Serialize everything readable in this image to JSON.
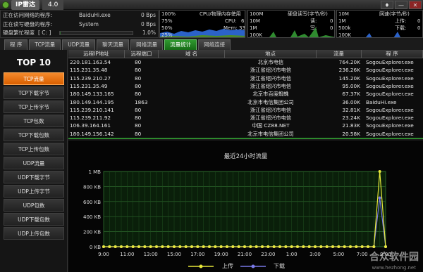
{
  "window": {
    "title": "IP雷达",
    "version": "4.0",
    "buttons": [
      "♦",
      "—",
      "✕"
    ]
  },
  "status": {
    "rows": [
      {
        "label": "正在访问网络的程序:",
        "app": "BaiduHi.exe",
        "value": "0 Bps"
      },
      {
        "label": "正在读写硬盘的程序:",
        "app": "System",
        "value": "0 Bps"
      },
      {
        "label": "硬盘繁忙程度",
        "drive": "[ C: ]",
        "value": "1.0%"
      }
    ],
    "disk_busy_percent": 1.0
  },
  "monitors": {
    "cpu": {
      "scale_top": "100%",
      "title": "CPU/物理内存使用",
      "l75": "75%",
      "cpu_label": "CPU:",
      "cpu_value": "6",
      "l50": "50%",
      "mem_label": "Mem:",
      "mem_value": "33",
      "l25": "25%"
    },
    "disk": {
      "scale_top": "100M",
      "title": "硬盘读写(字节/秒)",
      "l10m": "10M",
      "read_label": "读:",
      "read_value": "0",
      "l1m": "1M",
      "write_label": "写:",
      "write_value": "0",
      "l100k": "100K"
    },
    "net": {
      "scale_top": "10M",
      "title": "网速(字节/秒)",
      "l1m": "1M",
      "up_label": "上传:",
      "up_value": "0",
      "l500k": "500k",
      "down_label": "下载:",
      "down_value": "0",
      "l100k": "100K"
    }
  },
  "tabs": [
    "程 序",
    "TCP流量",
    "UDP流量",
    "聊天流量",
    "网络流量",
    "流量统计",
    "网络连接"
  ],
  "active_tab": 5,
  "sidebar": {
    "title": "TOP 10",
    "items": [
      "TCP流量",
      "TCP下载字节",
      "TCP上传字节",
      "TCP包数",
      "TCP下载包数",
      "TCP上传包数",
      "UDP流量",
      "UDP下载字节",
      "UDP上传字节",
      "UDP包数",
      "UDP下载包数",
      "UDP上传包数"
    ],
    "active": 0
  },
  "table": {
    "headers": [
      "远程IP地址",
      "远程端口",
      "域 名",
      "地点",
      "流量",
      "程 序"
    ],
    "rows": [
      [
        "220.181.163.54",
        "80",
        "",
        "北京市电信",
        "764.20K",
        "SogouExplorer.exe"
      ],
      [
        "115.231.35.48",
        "80",
        "",
        "浙江省绍兴市电信",
        "236.26K",
        "SogouExplorer.exe"
      ],
      [
        "115.239.210.27",
        "80",
        "",
        "浙江省绍兴市电信",
        "145.20K",
        "SogouExplorer.exe"
      ],
      [
        "115.231.35.49",
        "80",
        "",
        "浙江省绍兴市电信",
        "95.00K",
        "SogouExplorer.exe"
      ],
      [
        "180.149.133.165",
        "80",
        "",
        "北京市百度蜘蛛",
        "67.37K",
        "SogouExplorer.exe"
      ],
      [
        "180.149.144.195",
        "1863",
        "",
        "北京市电信集团公司",
        "36.00K",
        "BaiduHi.exe"
      ],
      [
        "115.239.210.141",
        "80",
        "",
        "浙江省绍兴市电信",
        "32.81K",
        "SogouExplorer.exe"
      ],
      [
        "115.239.211.92",
        "80",
        "",
        "浙江省绍兴市电信",
        "23.24K",
        "SogouExplorer.exe"
      ],
      [
        "106.39.164.161",
        "80",
        "",
        "中国 CZ88.NET",
        "21.83K",
        "SogouExplorer.exe"
      ],
      [
        "180.149.156.142",
        "80",
        "",
        "北京市电信集团公司",
        "20.58K",
        "SogouExplorer.exe"
      ]
    ]
  },
  "chart_data": {
    "type": "line",
    "title": "最近24小时流量",
    "x": [
      "9:00",
      "11:00",
      "13:00",
      "15:00",
      "17:00",
      "19:00",
      "21:00",
      "23:00",
      "1:00",
      "3:00",
      "5:00",
      "7:00",
      "9:00"
    ],
    "y_ticks": [
      "0 KB",
      "200 KB",
      "400 KB",
      "600 KB",
      "800 KB",
      "1 MB"
    ],
    "ylim": [
      0,
      1000
    ],
    "ylabel_unit": "KB",
    "points_per_hour": 2,
    "series": [
      {
        "name": "上传",
        "color": "#e8e83a",
        "nonzero": [
          [
            47,
            1000
          ]
        ]
      },
      {
        "name": "下载",
        "color": "#7a7ae8",
        "nonzero": [
          [
            47,
            650
          ]
        ]
      }
    ],
    "grid": true,
    "legend": "bottom"
  },
  "watermark": {
    "brand": "合众软件园",
    "url": "www.hezhong.net"
  }
}
